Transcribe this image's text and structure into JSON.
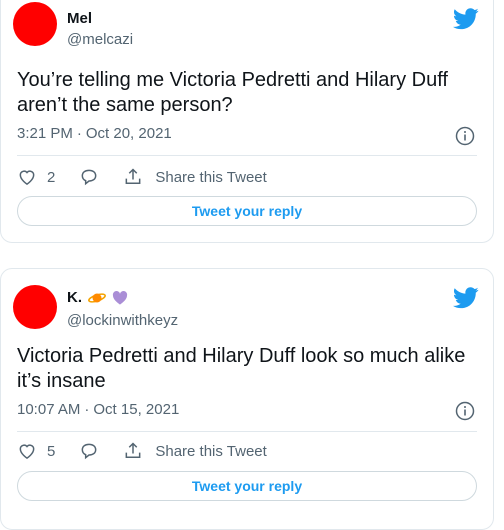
{
  "tweets": [
    {
      "name": "Mel",
      "name_emoji": [],
      "handle": "@melcazi",
      "text": "You’re telling me Victoria Pedretti and Hilary Duff aren’t the same person?",
      "time": "3:21 PM",
      "date": "Oct 20, 2021",
      "separator": "·",
      "likes": "2",
      "share_label": "Share this Tweet",
      "reply_label": "Tweet your reply"
    },
    {
      "name": "K.",
      "name_emoji": [
        "ringed-planet-emoji",
        "purple-heart-emoji"
      ],
      "handle": "@lockinwithkeyz",
      "text": "Victoria Pedretti and Hilary Duff look so much alike it’s insane",
      "time": "10:07 AM",
      "date": "Oct 15, 2021",
      "separator": "·",
      "likes": "5",
      "share_label": "Share this Tweet",
      "reply_label": "Tweet your reply"
    }
  ],
  "colors": {
    "avatar": "#ff0000",
    "twitter_blue": "#1d9bf0",
    "text_primary": "#0f1419",
    "text_secondary": "#536471",
    "border": "#e1e8ed"
  },
  "icons": [
    "twitter-bird-icon",
    "info-icon",
    "heart-icon",
    "reply-icon",
    "share-icon"
  ]
}
